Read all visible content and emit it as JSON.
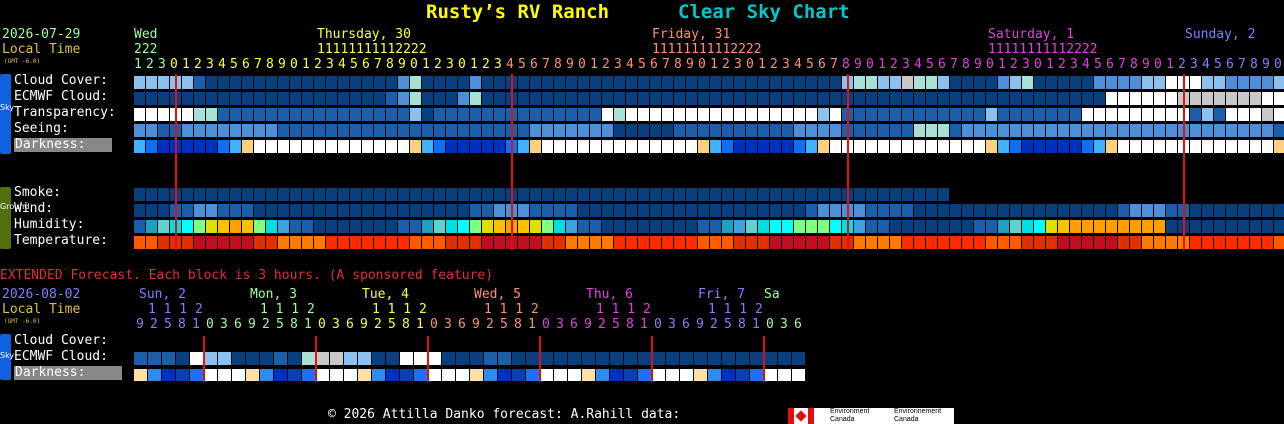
{
  "header": {
    "site_name": "Rusty’s RV Ranch",
    "chart_name": "Clear Sky Chart"
  },
  "main": {
    "date": "2026-07-29",
    "local_time_label": "Local Time",
    "gmt_note": "(GMT -6.0)",
    "days": [
      {
        "label": "Wed",
        "color": "#9fff9f"
      },
      {
        "label": "Thursday, 30",
        "color": "#ffff40"
      },
      {
        "label": "Friday, 31",
        "color": "#ff9070"
      },
      {
        "label": "Saturday, 1",
        "color": "#e040e0"
      },
      {
        "label": "Sunday, 2",
        "color": "#8080ff"
      }
    ],
    "tens_rows": [
      {
        "text": "222",
        "color": "#9fff9f"
      },
      {
        "text": "11111111112222",
        "color": "#ffff40"
      },
      {
        "text": "11111111112222",
        "color": "#ff9070"
      },
      {
        "text": "11111111112222",
        "color": "#e040e0"
      }
    ],
    "ones_text": "12301234567890123456789012301234567890123456789012301234567890123456789012301234567890123456789012301234567890123456",
    "sky_rows": [
      "Cloud Cover:",
      "ECMWF Cloud:",
      "Transparency:",
      "Seeing:",
      "Darkness:"
    ],
    "ground_rows": [
      "Smoke:",
      "Wind:",
      "Humidity:",
      "Temperature:"
    ],
    "sidebar_sky": "Sky",
    "sidebar_ground": "Ground"
  },
  "extended": {
    "note": "EXTENDED Forecast. Each block is 3 hours. (A sponsored feature)",
    "date": "2026-08-02",
    "local_time_label": "Local Time",
    "gmt_note": "(GMT -6.0)",
    "days": [
      {
        "label": "Sun, 2",
        "color": "#8080ff"
      },
      {
        "label": "Mon, 3",
        "color": "#9fff9f"
      },
      {
        "label": "Tue, 4",
        "color": "#ffff40"
      },
      {
        "label": "Wed, 5",
        "color": "#ff9070"
      },
      {
        "label": "Thu, 6",
        "color": "#e040e0"
      },
      {
        "label": "Fri, 7",
        "color": "#8080ff"
      },
      {
        "label": "Sa",
        "color": "#9fff9f"
      }
    ],
    "tens_rows": [
      {
        "text": "1112",
        "color": "#8080ff"
      },
      {
        "text": "1112",
        "color": "#9fff9f"
      },
      {
        "text": "1112",
        "color": "#ffff40"
      },
      {
        "text": "1112",
        "color": "#ff9070"
      },
      {
        "text": "1112",
        "color": "#e040e0"
      },
      {
        "text": "1112",
        "color": "#8080ff"
      }
    ],
    "ones_groups": [
      {
        "text": "92581",
        "color": "#8080ff"
      },
      {
        "text": "03692581",
        "color": "#9fff9f"
      },
      {
        "text": "03692581",
        "color": "#ffff40"
      },
      {
        "text": "03692581",
        "color": "#ff9070"
      },
      {
        "text": "03692581",
        "color": "#e040e0"
      },
      {
        "text": "03692581",
        "color": "#8080ff"
      },
      {
        "text": "036",
        "color": "#9fff9f"
      }
    ],
    "sky_rows": [
      "Cloud Cover:",
      "ECMWF Cloud:",
      "Darkness:"
    ],
    "sidebar_sky": "Sky"
  },
  "footer": {
    "text": "© 2026 Attilla Danko  forecast: A.Rahill  data:",
    "logo_en_1": "Environment",
    "logo_en_2": "Canada",
    "logo_fr_1": "Environnement",
    "logo_fr_2": "Canada"
  },
  "colors": {
    "title_yellow": "#ffff00",
    "title_cyan": "#00c8c8",
    "date_green": "#9fff9f",
    "local_time": "#e0c040",
    "extended_red": "#e03030",
    "sky_sidebar": "#1060e0",
    "ground_sidebar": "#507010",
    "midnight_line": "#e01010"
  }
}
